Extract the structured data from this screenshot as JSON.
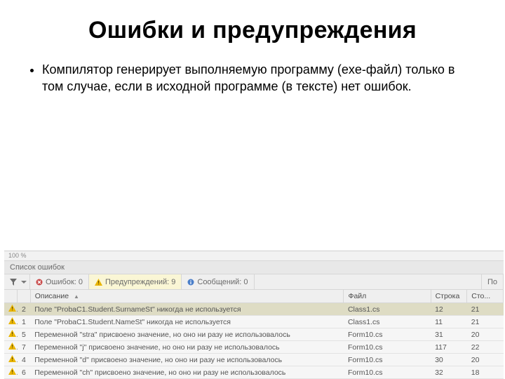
{
  "title": "Ошибки и предупреждения",
  "bullet": "Компилятор генерирует выполняемую программу (exe-файл) только в том случае, если в исходной программе (в тексте) нет ошибок.",
  "panel": {
    "zoom": "100 %",
    "title": "Список ошибок",
    "tabs": {
      "errors": "Ошибок: 0",
      "warnings": "Предупреждений: 9",
      "messages": "Сообщений: 0",
      "search": "По"
    },
    "headers": {
      "description": "Описание",
      "file": "Файл",
      "line": "Строка",
      "column": "Сто..."
    }
  },
  "items": [
    {
      "n": "2",
      "desc": "Поле \"ProbaC1.Student.SurnameSt\" никогда не используется",
      "file": "Class1.cs",
      "line": "12",
      "col": "21",
      "selected": true
    },
    {
      "n": "1",
      "desc": "Поле \"ProbaC1.Student.NameSt\" никогда не используется",
      "file": "Class1.cs",
      "line": "11",
      "col": "21",
      "selected": false
    },
    {
      "n": "5",
      "desc": "Переменной \"stra\" присвоено значение, но оно ни разу не использовалось",
      "file": "Form10.cs",
      "line": "31",
      "col": "20",
      "selected": false
    },
    {
      "n": "7",
      "desc": "Переменной \"j\" присвоено значение, но оно ни разу не использовалось",
      "file": "Form10.cs",
      "line": "117",
      "col": "22",
      "selected": false
    },
    {
      "n": "4",
      "desc": "Переменной \"d\" присвоено значение, но оно ни разу не использовалось",
      "file": "Form10.cs",
      "line": "30",
      "col": "20",
      "selected": false
    },
    {
      "n": "6",
      "desc": "Переменной \"ch\" присвоено значение, но оно ни разу не использовалось",
      "file": "Form10.cs",
      "line": "32",
      "col": "18",
      "selected": false
    }
  ]
}
